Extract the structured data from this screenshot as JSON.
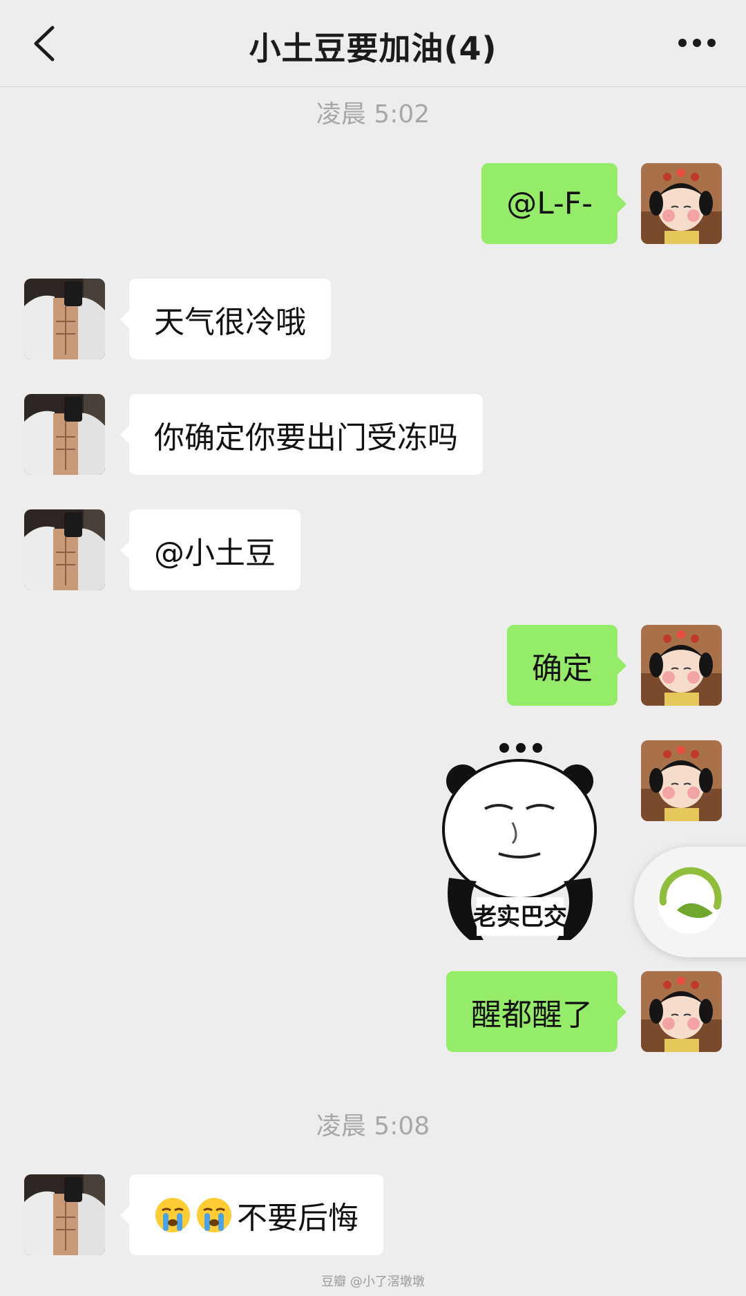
{
  "header": {
    "title": "小土豆要加油(4)"
  },
  "timestamps": [
    "凌晨 5:02",
    "凌晨 5:08"
  ],
  "messages": [
    {
      "side": "out",
      "text": "@L-F-"
    },
    {
      "side": "in",
      "text": "天气很冷哦"
    },
    {
      "side": "in",
      "text": "你确定你要出门受冻吗"
    },
    {
      "side": "in",
      "text": "@小土豆"
    },
    {
      "side": "out",
      "text": "确定"
    },
    {
      "side": "out",
      "sticker_text": "老实巴交"
    },
    {
      "side": "out",
      "text": "醒都醒了"
    },
    {
      "side": "in",
      "emoji": [
        "crying-face-emoji",
        "crying-face-emoji"
      ],
      "text": "不要后悔"
    }
  ],
  "watermark": "豆瓣  @小了滘墩墩",
  "colors": {
    "background": "#ededed",
    "outgoing_bubble": "#95ec69",
    "incoming_bubble": "#ffffff"
  }
}
